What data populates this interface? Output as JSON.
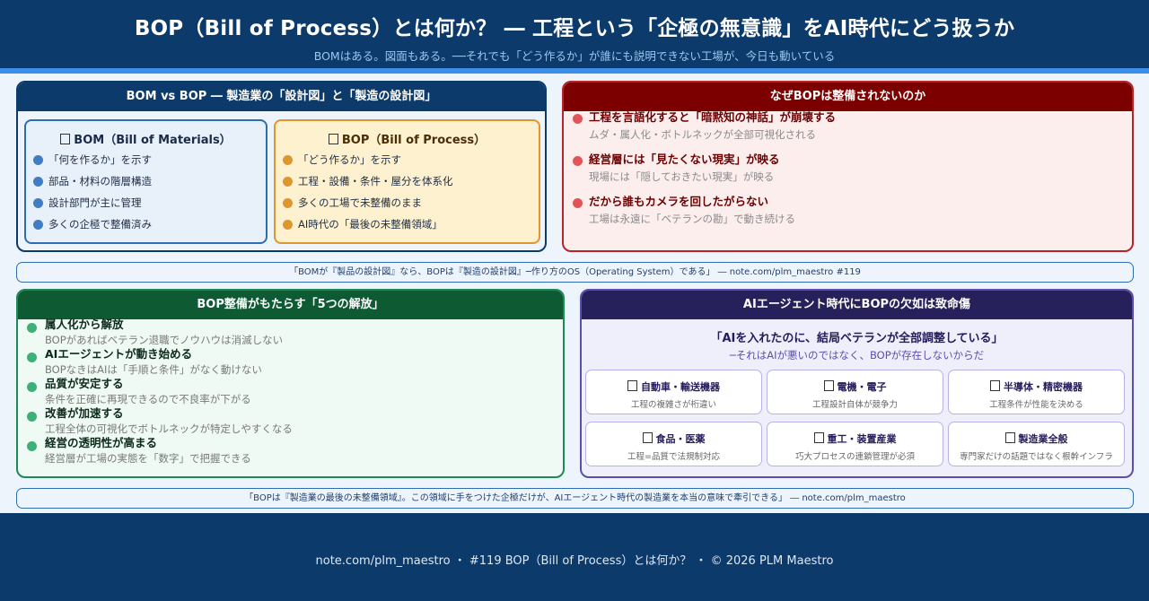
{
  "header": {
    "title": "BOP（Bill of Process）とは何か？ ― 工程という「企極の無意識」をAI時代にどう扱うか",
    "subtitle": "BOMはある。図面もある。──それでも「どう作るか」が誰にも説明できない工場が、今日も動いている"
  },
  "bom_bop": {
    "title": "BOM vs BOP ― 製造業の「設計図」と「製造の設計図」",
    "bom": {
      "heading": "BOM（Bill of Materials）",
      "items": [
        "「何を作るか」を示す",
        "部品・材料の階層構造",
        "設計部門が主に管理",
        "多くの企極で整備済み"
      ]
    },
    "bop": {
      "heading": "BOP（Bill of Process）",
      "items": [
        "「どう作るか」を示す",
        "工程・設備・条件・屋分を体系化",
        "多くの工場で未整備のまま",
        "AI時代の「最後の未整備領域」"
      ]
    }
  },
  "why": {
    "title": "なぜBOPは整備されないのか",
    "items": [
      {
        "title": "工程を言語化すると「暗黙知の神話」が崩壊する",
        "desc": "ムダ・属人化・ボトルネックが全部可視化される"
      },
      {
        "title": "経営層には「見たくない現実」が映る",
        "desc": "現場には「隠しておきたい現実」が映る"
      },
      {
        "title": "だから誰もカメラを回したがらない",
        "desc": "工場は永遠に「ベテランの勘」で動き続ける"
      }
    ]
  },
  "quote1": "「BOMが『製品の設計図』なら、BOPは『製造の設計図』─作り方のOS（Operating System）である」 ― note.com/plm_maestro #119",
  "five": {
    "title": "BOP整備がもたらす「5つの解放」",
    "items": [
      {
        "title": "属人化から解放",
        "desc": "BOPがあればベテラン退職でノウハウは消滅しない"
      },
      {
        "title": "AIエージェントが動き始める",
        "desc": "BOPなきはAIは「手順と条件」がなく動けない"
      },
      {
        "title": "品質が安定する",
        "desc": "条件を正確に再現できるので不良率が下がる"
      },
      {
        "title": "改善が加速する",
        "desc": "工程全体の可視化でボトルネックが特定しやすくなる"
      },
      {
        "title": "経営の透明性が高まる",
        "desc": "経営層が工場の実態を「数字」で把握できる"
      }
    ]
  },
  "ai": {
    "title": "AIエージェント時代にBOPの欠如は致命傷",
    "quote": "「AIを入れたのに、結局ベテランが全部調整している」",
    "sub": "─それはAIが悪いのではなく、BOPが存在しないからだ",
    "industries": [
      {
        "name": "自動車・輸送機器",
        "desc": "工程の複雑さが桁違い"
      },
      {
        "name": "電機・電子",
        "desc": "工程設計自体が競争力"
      },
      {
        "name": "半導体・精密機器",
        "desc": "工程条件が性能を決める"
      },
      {
        "name": "食品・医薬",
        "desc": "工程=品質で法規制対応"
      },
      {
        "name": "重工・装置産業",
        "desc": "巧大プロセスの連鎖管理が必須"
      },
      {
        "name": "製造業全般",
        "desc": "専門家だけの話題ではなく根幹インフラ"
      }
    ]
  },
  "quote2": "「BOPは『製造業の最後の未整備領域』。この領域に手をつけた企極だけが、AIエージェント時代の製造業を本当の意味で牽引できる」 ― note.com/plm_maestro",
  "footer": "note.com/plm_maestro ・ #119 BOP（Bill of Process）とは何か？ ・ © 2026 PLM Maestro",
  "colors": {
    "navy": "#0b3a6b",
    "accent": "#3d8ee8",
    "red": "#7d0000",
    "green": "#0d5a33",
    "purple": "#26215a",
    "orange": "#e0962f"
  }
}
